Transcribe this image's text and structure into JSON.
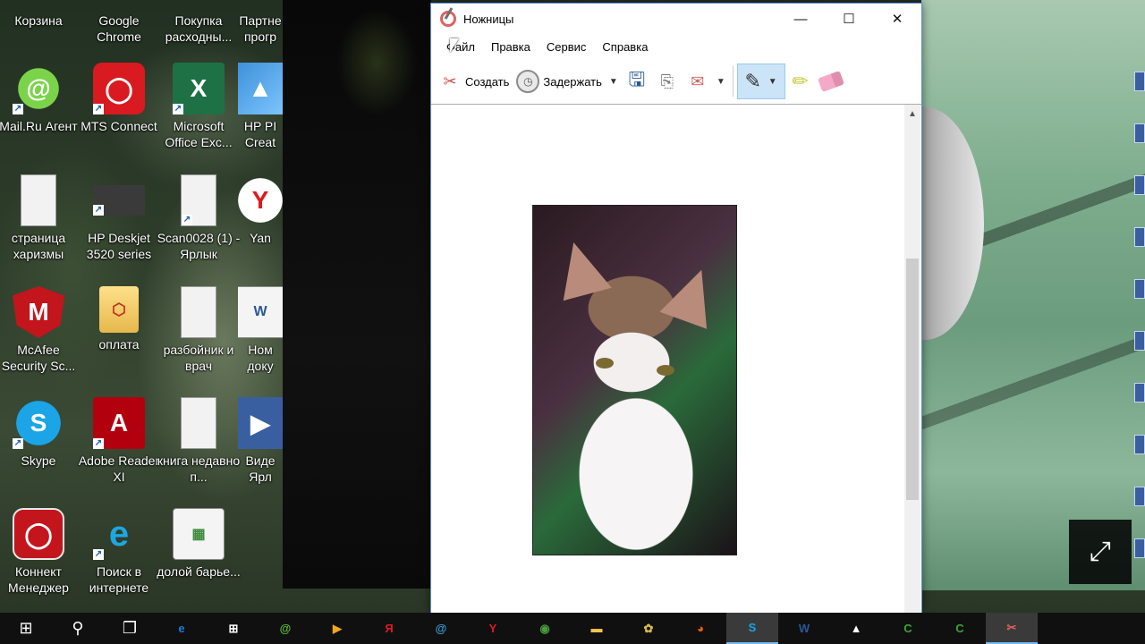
{
  "desktop": {
    "icons": [
      {
        "label": "Корзина",
        "glyph": "🗑"
      },
      {
        "label": "Google Chrome",
        "glyph": "◉"
      },
      {
        "label": "Покупка расходны...",
        "glyph": "🛒"
      },
      {
        "label": "Партне прогр",
        "glyph": "🌐"
      },
      {
        "label": "Mail.Ru Агент",
        "glyph": "@"
      },
      {
        "label": "MTS Connect",
        "glyph": "◯"
      },
      {
        "label": "Microsoft Office Exc...",
        "glyph": "X"
      },
      {
        "label": "HP PI Creat",
        "glyph": "▲"
      },
      {
        "label": "страница харизмы",
        "glyph": ""
      },
      {
        "label": "HP Deskjet 3520 series",
        "glyph": ""
      },
      {
        "label": "Scan0028 (1) - Ярлык",
        "glyph": ""
      },
      {
        "label": "Yan",
        "glyph": "Y"
      },
      {
        "label": "McAfee Security Sc...",
        "glyph": "M"
      },
      {
        "label": "оплата",
        "glyph": "⬡"
      },
      {
        "label": "разбойник и врач",
        "glyph": ""
      },
      {
        "label": "Ном доку",
        "glyph": "W"
      },
      {
        "label": "Skype",
        "glyph": "S"
      },
      {
        "label": "Adobe Reader XI",
        "glyph": "A"
      },
      {
        "label": "книга недавно п...",
        "glyph": ""
      },
      {
        "label": "Виде Ярл",
        "glyph": "▶"
      },
      {
        "label": "Коннект Менеджер",
        "glyph": "◯"
      },
      {
        "label": "Поиск в интернете",
        "glyph": "e"
      },
      {
        "label": "долой барье...",
        "glyph": "▦"
      }
    ]
  },
  "window": {
    "title": "Ножницы",
    "controls": {
      "minimize": "—",
      "maximize": "☐",
      "close": "✕"
    },
    "menu": [
      "Файл",
      "Правка",
      "Сервис",
      "Справка"
    ],
    "toolbar": {
      "create_label": "Создать",
      "delay_label": "Задержать",
      "dropdown_arrow": "▼"
    },
    "scroll_up": "▲"
  },
  "overlay": {
    "expand_glyph": "⤢"
  },
  "taskbar": {
    "start": "⊞",
    "search": "⚲",
    "taskview": "❐",
    "apps": [
      {
        "name": "edge",
        "glyph": "e",
        "color": "#1f7ae0"
      },
      {
        "name": "store",
        "glyph": "⊞",
        "color": "#ffffff"
      },
      {
        "name": "mailru-agent",
        "glyph": "@",
        "color": "#5cbf2a"
      },
      {
        "name": "media-player",
        "glyph": "▶",
        "color": "#f2a81d"
      },
      {
        "name": "yandex-browser",
        "glyph": "Я",
        "color": "#e0191b"
      },
      {
        "name": "mail-client",
        "glyph": "@",
        "color": "#3b9fd8"
      },
      {
        "name": "yandex",
        "glyph": "Y",
        "color": "#e0191b"
      },
      {
        "name": "chrome",
        "glyph": "◉",
        "color": "#4a9a3f"
      },
      {
        "name": "file-explorer",
        "glyph": "▬",
        "color": "#f5c44e"
      },
      {
        "name": "game",
        "glyph": "✿",
        "color": "#d9b94a"
      },
      {
        "name": "firefox",
        "glyph": "◕",
        "color": "#e66000"
      },
      {
        "name": "skype",
        "glyph": "S",
        "color": "#1ba4e6"
      },
      {
        "name": "word-app",
        "glyph": "W",
        "color": "#2b5797"
      },
      {
        "name": "photos",
        "glyph": "▲",
        "color": "#ffffff"
      },
      {
        "name": "camtasia",
        "glyph": "C",
        "color": "#3fa535"
      },
      {
        "name": "camtasia-recorder",
        "glyph": "C",
        "color": "#3fa535"
      },
      {
        "name": "snipping-tool",
        "glyph": "✂",
        "color": "#e06060"
      }
    ]
  }
}
